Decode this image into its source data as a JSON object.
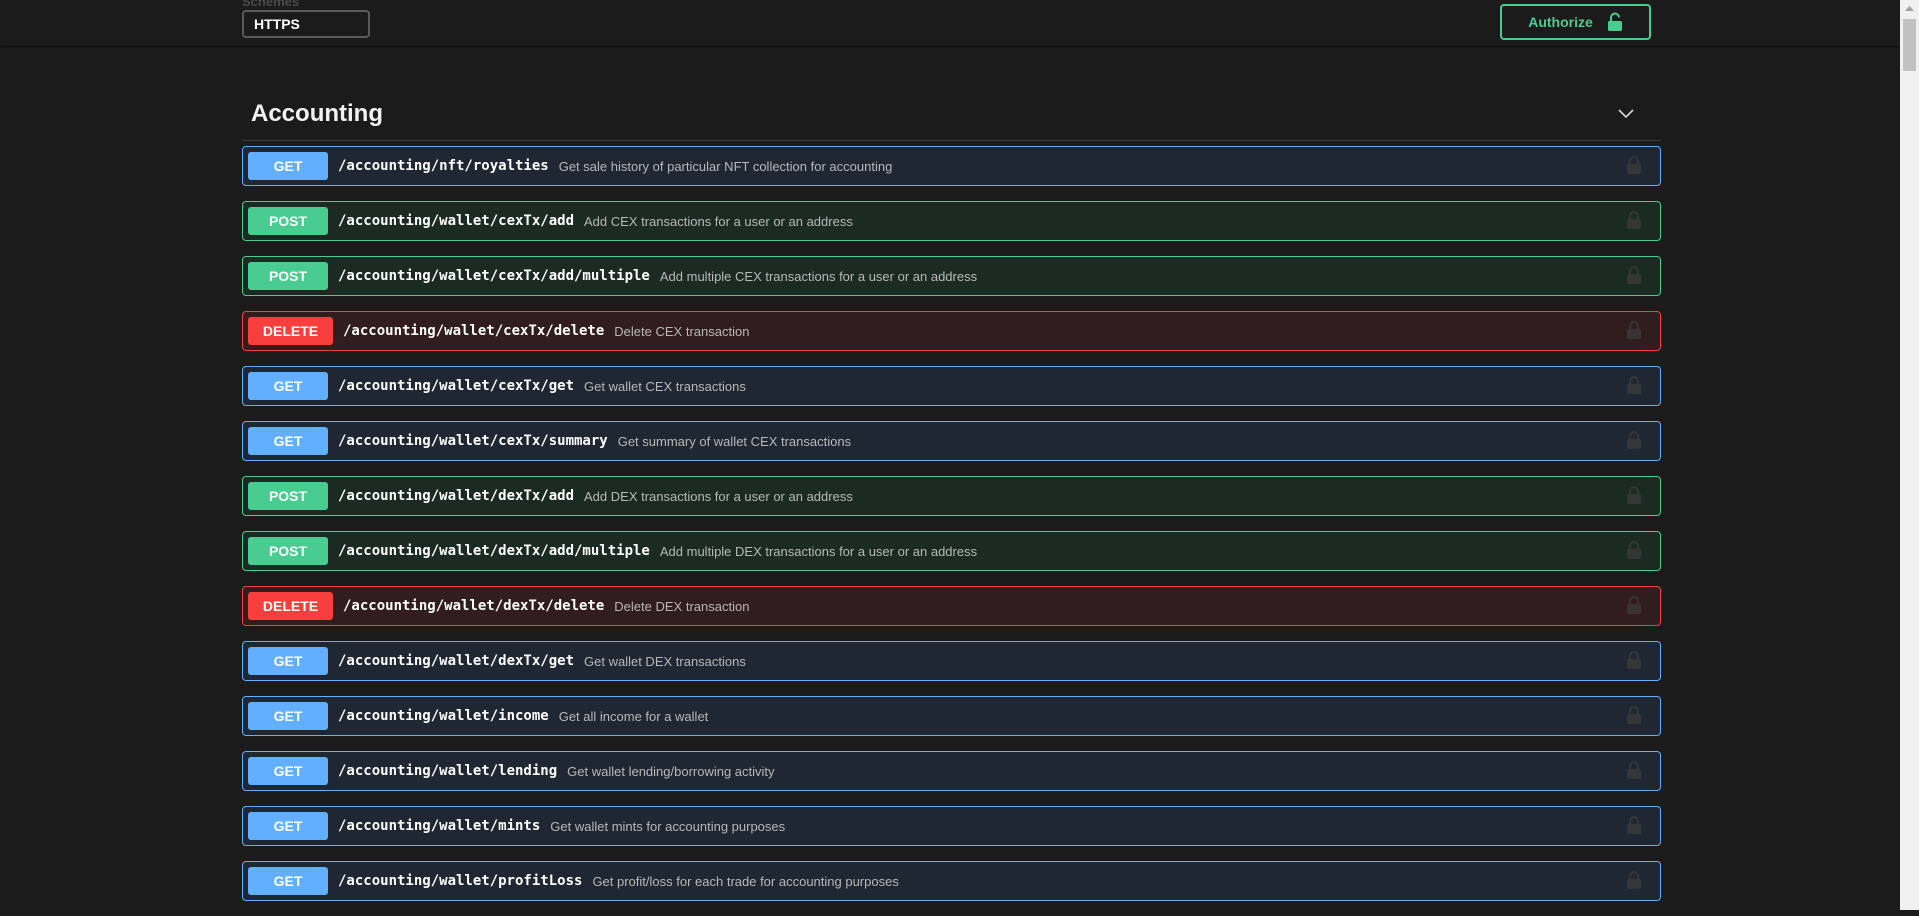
{
  "header": {
    "schemes_label": "Schemes",
    "scheme_value": "HTTPS",
    "authorize_label": "Authorize"
  },
  "section": {
    "title": "Accounting"
  },
  "colors": {
    "get": "#61affe",
    "post": "#49cc90",
    "delete": "#f93e3e",
    "background": "#1b1b1b"
  },
  "icons": {
    "authorize": "unlock-icon",
    "collapse": "chevron-down-icon",
    "operation_lock": "lock-icon"
  },
  "operations": [
    {
      "method": "GET",
      "path": "/accounting/nft/royalties",
      "summary": "Get sale history of particular NFT collection for accounting"
    },
    {
      "method": "POST",
      "path": "/accounting/wallet/cexTx/add",
      "summary": "Add CEX transactions for a user or an address"
    },
    {
      "method": "POST",
      "path": "/accounting/wallet/cexTx/add/multiple",
      "summary": "Add multiple CEX transactions for a user or an address"
    },
    {
      "method": "DELETE",
      "path": "/accounting/wallet/cexTx/delete",
      "summary": "Delete CEX transaction"
    },
    {
      "method": "GET",
      "path": "/accounting/wallet/cexTx/get",
      "summary": "Get wallet CEX transactions"
    },
    {
      "method": "GET",
      "path": "/accounting/wallet/cexTx/summary",
      "summary": "Get summary of wallet CEX transactions"
    },
    {
      "method": "POST",
      "path": "/accounting/wallet/dexTx/add",
      "summary": "Add DEX transactions for a user or an address"
    },
    {
      "method": "POST",
      "path": "/accounting/wallet/dexTx/add/multiple",
      "summary": "Add multiple DEX transactions for a user or an address"
    },
    {
      "method": "DELETE",
      "path": "/accounting/wallet/dexTx/delete",
      "summary": "Delete DEX transaction"
    },
    {
      "method": "GET",
      "path": "/accounting/wallet/dexTx/get",
      "summary": "Get wallet DEX transactions"
    },
    {
      "method": "GET",
      "path": "/accounting/wallet/income",
      "summary": "Get all income for a wallet"
    },
    {
      "method": "GET",
      "path": "/accounting/wallet/lending",
      "summary": "Get wallet lending/borrowing activity"
    },
    {
      "method": "GET",
      "path": "/accounting/wallet/mints",
      "summary": "Get wallet mints for accounting purposes"
    },
    {
      "method": "GET",
      "path": "/accounting/wallet/profitLoss",
      "summary": "Get profit/loss for each trade for accounting purposes"
    }
  ]
}
